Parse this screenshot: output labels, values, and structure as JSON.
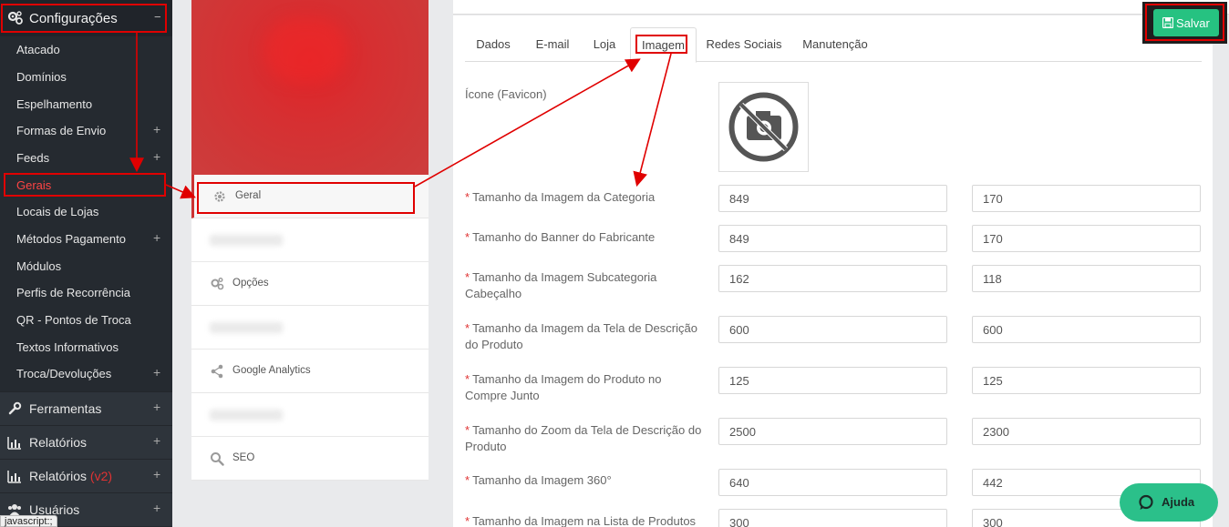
{
  "sidebar": {
    "header": {
      "label": "Configurações",
      "icon": "gears-icon",
      "toggle": "−"
    },
    "sub_items": [
      {
        "label": "Atacado",
        "plus": ""
      },
      {
        "label": "Domínios",
        "plus": ""
      },
      {
        "label": "Espelhamento",
        "plus": ""
      },
      {
        "label": "Formas de Envio",
        "plus": "+"
      },
      {
        "label": "Feeds",
        "plus": "+"
      },
      {
        "label": "Gerais",
        "plus": ""
      },
      {
        "label": "Locais de Lojas",
        "plus": ""
      },
      {
        "label": "Métodos Pagamento",
        "plus": "+"
      },
      {
        "label": "Módulos",
        "plus": ""
      },
      {
        "label": "Perfis de Recorrência",
        "plus": ""
      },
      {
        "label": "QR - Pontos de Troca",
        "plus": ""
      },
      {
        "label": "Textos Informativos",
        "plus": ""
      },
      {
        "label": "Troca/Devoluções",
        "plus": "+"
      }
    ],
    "main_items": [
      {
        "label": "Ferramentas",
        "icon": "wrench-icon",
        "plus": "+"
      },
      {
        "label": "Relatórios",
        "icon": "bar-chart-icon",
        "plus": "+"
      },
      {
        "label": "Relatórios",
        "suffix": "(v2)",
        "icon": "bar-chart-icon",
        "plus": "+"
      },
      {
        "label": "Usuários",
        "icon": "users-icon",
        "plus": "+"
      }
    ]
  },
  "status_bar": "javascript:;",
  "settings_menu": {
    "items": [
      {
        "label": "Geral",
        "icon": "gear-icon",
        "active": true
      },
      {
        "label": "",
        "icon": "blurred-icon",
        "blurred": true
      },
      {
        "label": "Opções",
        "icon": "gears-icon"
      },
      {
        "label": "",
        "icon": "blurred-icon",
        "blurred": true
      },
      {
        "label": "Google Analytics",
        "icon": "share-icon"
      },
      {
        "label": "",
        "icon": "blurred-icon",
        "blurred": true
      },
      {
        "label": "SEO",
        "icon": "search-icon"
      }
    ]
  },
  "tabs": [
    "Dados",
    "E-mail",
    "Loja",
    "Imagem",
    "Redes Sociais",
    "Manutenção"
  ],
  "active_tab": "Imagem",
  "favicon_label": "Ícone (Favicon)",
  "required_marker": "*",
  "fields": [
    {
      "label": "Tamanho da Imagem da Categoria",
      "width": "849",
      "height": "170"
    },
    {
      "label": "Tamanho do Banner do Fabricante",
      "width": "849",
      "height": "170"
    },
    {
      "label": "Tamanho da Imagem Subcategoria Cabeçalho",
      "width": "162",
      "height": "118"
    },
    {
      "label": "Tamanho da Imagem da Tela de Descrição do Produto",
      "width": "600",
      "height": "600"
    },
    {
      "label": "Tamanho da Imagem do Produto no Compre Junto",
      "width": "125",
      "height": "125"
    },
    {
      "label": "Tamanho do Zoom da Tela de Descrição do Produto",
      "width": "2500",
      "height": "2300"
    },
    {
      "label": "Tamanho da Imagem 360°",
      "width": "640",
      "height": "442"
    },
    {
      "label": "Tamanho da Imagem na Lista de Produtos",
      "width": "300",
      "height": "300"
    }
  ],
  "save_button": {
    "label": "Salvar",
    "icon": "floppy-icon"
  },
  "help_button": {
    "label": "Ajuda",
    "icon": "chat-bubble-icon"
  },
  "colors": {
    "sidebar_bg": "#252a30",
    "accent_green": "#26c281",
    "highlight_red": "#e00000",
    "banner_red": "#d63032"
  }
}
